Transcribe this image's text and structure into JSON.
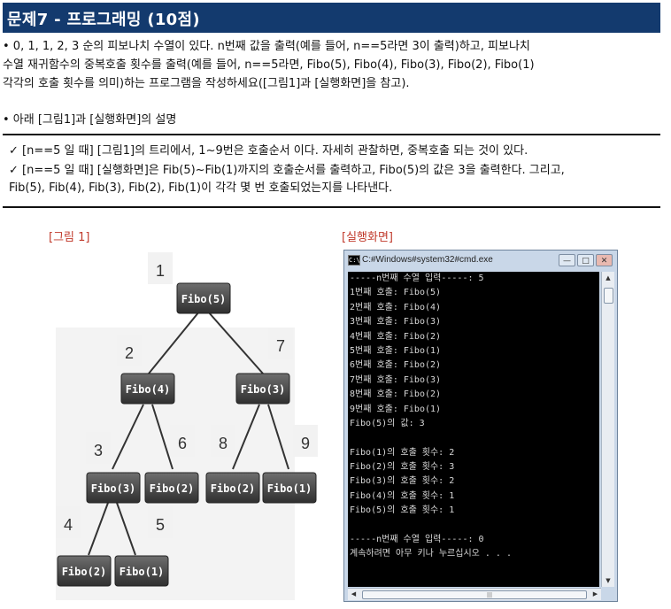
{
  "title": "문제7 - 프로그래밍 (10점)",
  "bullet1": {
    "line1": "•  0, 1, 1, 2, 3 순의 피보나치 수열이 있다. n번째 값을 출력(예를 들어, n==5라면 3이 출력)하고, 피보나치",
    "line2": "   수열 재귀함수의 중복호출 횟수를 출력(예를 들어, n==5라면, Fibo(5), Fibo(4), Fibo(3), Fibo(2), Fibo(1)",
    "line3": "   각각의 호출 횟수를 의미)하는 프로그램을 작성하세요([그림1]과 [실행화면]을 참고)."
  },
  "bullet2": "•  아래 [그림1]과 [실행화면]의 설명",
  "check1": "✓   [n==5 일 때] [그림1]의 트리에서, 1~9번은 호출순서 이다. 자세히 관찰하면, 중복호출 되는 것이 있다.",
  "check2": {
    "line1": "✓   [n==5 일 때] [실행화면]은 Fib(5)~Fib(1)까지의 호출순서를 출력하고, Fibo(5)의 값은 3을 출력한다. 그리고,",
    "line2": "    Fib(5), Fib(4), Fib(3), Fib(2), Fib(1)이 각각 몇 번 호출되었는지를 나타낸다."
  },
  "figure_caption": "[그림 1]",
  "screen_caption": "[실행화면]",
  "tree": {
    "nodes": [
      "Fibo(5)",
      "Fibo(4)",
      "Fibo(3)",
      "Fibo(3)",
      "Fibo(2)",
      "Fibo(2)",
      "Fibo(1)",
      "Fibo(2)",
      "Fibo(1)"
    ],
    "order": [
      "1",
      "2",
      "7",
      "3",
      "6",
      "8",
      "9",
      "4",
      "5"
    ]
  },
  "cmd": {
    "window_title": "C:#Windows#system32#cmd.exe",
    "buttons": {
      "minimize": "—",
      "maximize": "□",
      "close": "✕"
    },
    "lines": [
      "-----n번째 수열 입력-----: 5",
      "1번째 호출: Fibo(5)",
      "2번째 호출: Fibo(4)",
      "3번째 호출: Fibo(3)",
      "4번째 호출: Fibo(2)",
      "5번째 호출: Fibo(1)",
      "6번째 호출: Fibo(2)",
      "7번째 호출: Fibo(3)",
      "8번째 호출: Fibo(2)",
      "9번째 호출: Fibo(1)",
      "Fibo(5)의 값: 3",
      "",
      "Fibo(1)의 호출 횟수: 2",
      "Fibo(2)의 호출 횟수: 3",
      "Fibo(3)의 호출 횟수: 2",
      "Fibo(4)의 호출 횟수: 1",
      "Fibo(5)의 호출 횟수: 1",
      "",
      "-----n번째 수열 입력-----: 0",
      "계속하려면 아무 키나 누르십시오 . . ."
    ]
  }
}
